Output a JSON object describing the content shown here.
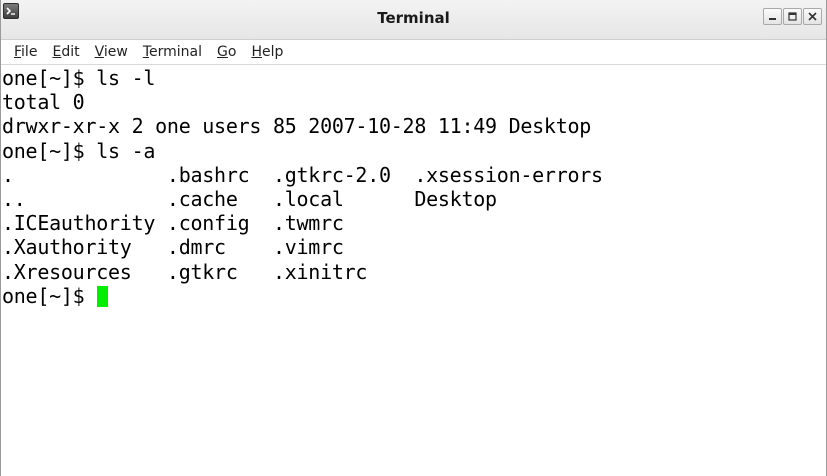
{
  "window": {
    "title": "Terminal",
    "controls": [
      "minimize",
      "maximize",
      "close"
    ]
  },
  "menubar": {
    "items": [
      "File",
      "Edit",
      "View",
      "Terminal",
      "Go",
      "Help"
    ]
  },
  "terminal": {
    "lines": [
      "one[~]$ ls -l",
      "total 0",
      "drwxr-xr-x 2 one users 85 2007-10-28 11:49 Desktop",
      "one[~]$ ls -a",
      ".             .bashrc  .gtkrc-2.0  .xsession-errors",
      "..            .cache   .local      Desktop",
      ".ICEauthority .config  .twmrc",
      ".Xauthority   .dmrc    .vimrc",
      ".Xresources   .gtkrc   .xinitrc"
    ],
    "prompt": "one[~]$ ",
    "cursor_color": "#00ee00"
  },
  "icons": {
    "app": "terminal-app-icon",
    "minimize": "minimize-icon",
    "maximize": "maximize-icon",
    "close": "close-icon"
  }
}
